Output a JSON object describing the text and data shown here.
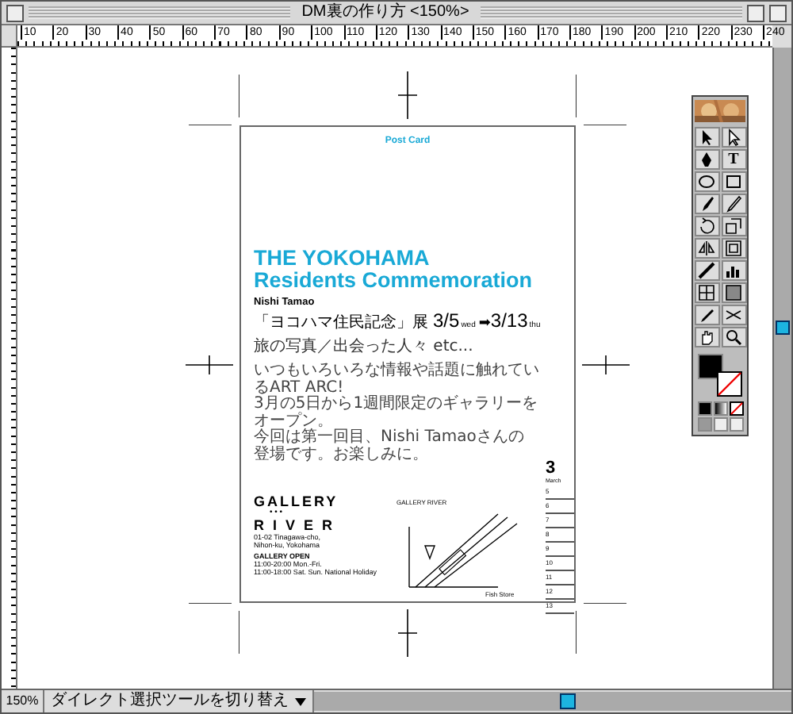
{
  "window": {
    "title": "DM裏の作り方 <150%>"
  },
  "ruler": {
    "labels": [
      "10",
      "20",
      "30",
      "40",
      "50",
      "60",
      "70",
      "80",
      "90",
      "100",
      "110",
      "120",
      "130",
      "140",
      "150",
      "160",
      "170",
      "180",
      "190",
      "200",
      "210",
      "220",
      "230",
      "240"
    ]
  },
  "postcard": {
    "header": "Post Card",
    "title_lines": [
      "THE YOKOHAMA",
      "Residents Commemoration"
    ],
    "artist": "Nishi Tamao",
    "exhibition": "「ヨコハマ住民記念」展",
    "start_date": "3/5",
    "start_day": "wed",
    "arrow": "➡",
    "end_date": "3/13",
    "end_day": "thu",
    "subtitle": "旅の写真／出会った人々 etc...",
    "intro": [
      "いつもいろいろな情報や話題に触れているART ARC!",
      "3月の5日から1週間限定のギャラリーをオープン。",
      "今回は第一回目、Nishi Tamaoさんの登場です。お楽しみに。"
    ],
    "gallery_name": "GALLERY",
    "gallery_dots": "• • •",
    "gallery_name_2": "R I V E R",
    "address": [
      "01-02 Tinagawa-cho,",
      "Nihon-ku, Yokohama"
    ],
    "hours_title": "GALLERY OPEN",
    "hours": [
      "11:00-20:00 Mon.-Fri.",
      "11:00-18:00 Sat. Sun. National Holiday"
    ],
    "map": {
      "gallery_label": "GALLERY RIVER",
      "store_label": "Fish Store"
    },
    "calendar": {
      "month_number": "3",
      "month_name": "March",
      "days": [
        "5",
        "6",
        "7",
        "8",
        "9",
        "10",
        "11",
        "12",
        "13"
      ]
    }
  },
  "toolbox": {
    "type_tool_label": "T"
  },
  "status_bar": {
    "zoom": "150%",
    "tool_hint": "ダイレクト選択ツールを切り替え"
  }
}
